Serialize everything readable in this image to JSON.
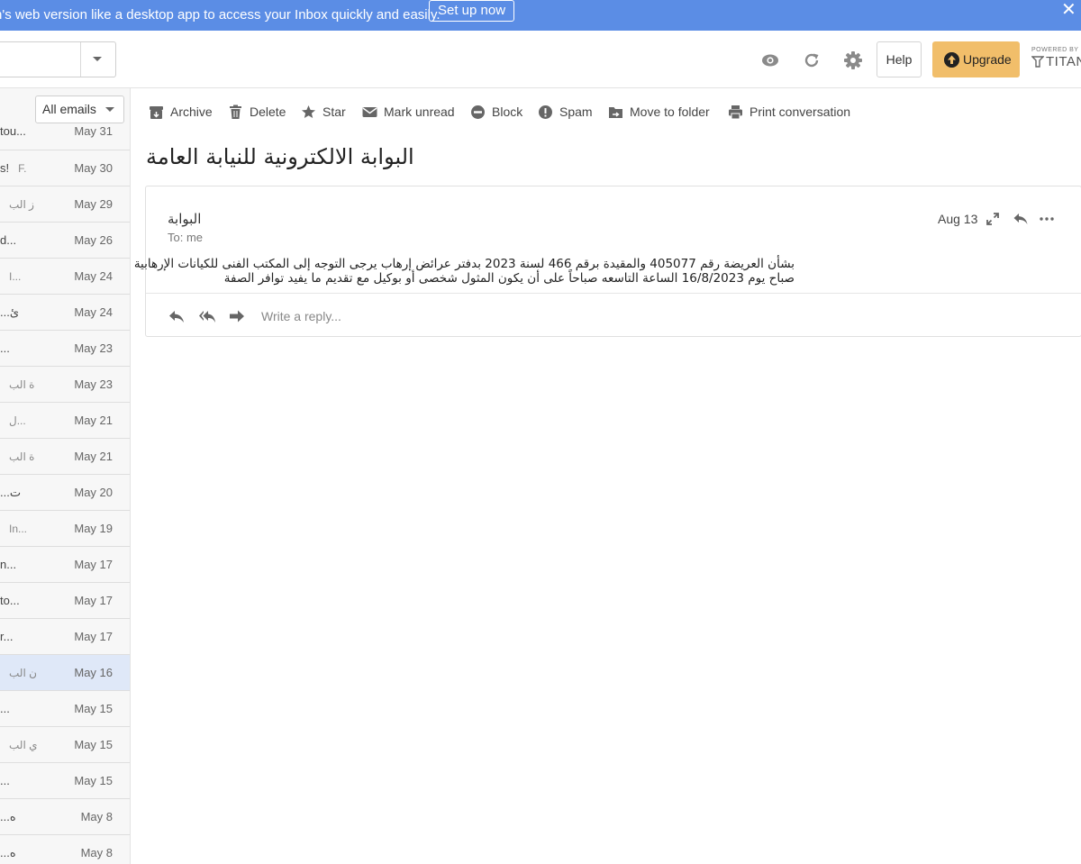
{
  "banner": {
    "text": "n's web version like a desktop app to access your Inbox quickly and easily.",
    "button_label": "Set up now",
    "close_glyph": "✕"
  },
  "header": {
    "help_label": "Help",
    "upgrade_label": "Upgrade",
    "powered_by": "POWERED BY",
    "brand": "TITAN",
    "icons": [
      "eye-icon",
      "refresh-icon",
      "settings-icon"
    ]
  },
  "sidebar": {
    "filter_value": "All emails",
    "rows": [
      {
        "snippet": "tou...",
        "date": "May 31"
      },
      {
        "snippet": "s!",
        "extra": "F.",
        "date": "May 30"
      },
      {
        "snippet": "",
        "extra": "ز  الب",
        "date": "May 29"
      },
      {
        "snippet": "d...",
        "date": "May 26"
      },
      {
        "snippet": "",
        "extra": "I...",
        "date": "May 24"
      },
      {
        "snippet": "...ئ",
        "date": "May 24"
      },
      {
        "snippet": "...",
        "date": "May 23"
      },
      {
        "snippet": "",
        "extra": "ة  الب",
        "date": "May 23"
      },
      {
        "snippet": "",
        "extra": "ل...",
        "date": "May 21"
      },
      {
        "snippet": "",
        "extra": "ة  الب",
        "date": "May 21"
      },
      {
        "snippet": "...ت",
        "date": "May 20"
      },
      {
        "snippet": "",
        "extra": "In...",
        "date": "May 19"
      },
      {
        "snippet": "n...",
        "date": "May 17"
      },
      {
        "snippet": "to...",
        "date": "May 17"
      },
      {
        "snippet": "r...",
        "date": "May 17"
      },
      {
        "snippet": "",
        "extra": "ن  الب",
        "date": "May 16",
        "selected": true
      },
      {
        "snippet": "...",
        "date": "May 15"
      },
      {
        "snippet": "",
        "extra": "ي  الب",
        "date": "May 15"
      },
      {
        "snippet": "...",
        "date": "May 15"
      },
      {
        "snippet": "...ه",
        "date": "May 8"
      },
      {
        "snippet": "...ه",
        "date": "May 8"
      }
    ]
  },
  "toolbar": {
    "items": [
      {
        "label": "Archive",
        "icon": "archive-icon"
      },
      {
        "label": "Delete",
        "icon": "trash-icon"
      },
      {
        "label": "Star",
        "icon": "star-icon"
      },
      {
        "label": "Mark unread",
        "icon": "envelope-icon"
      },
      {
        "label": "Block",
        "icon": "block-icon"
      },
      {
        "label": "Spam",
        "icon": "spam-icon"
      },
      {
        "label": "Move to folder",
        "icon": "folder-move-icon"
      },
      {
        "label": "Print conversation",
        "icon": "print-icon"
      }
    ]
  },
  "message": {
    "subject": "البوابة الالكترونية للنيابة العامة",
    "sender": "البوابة",
    "to": "To: me",
    "date": "Aug 13",
    "body_line1": "بشأن العريضة رقم 405077 والمقيدة برقم 466 لسنة 2023 بدفتر عرائض إرهاب يرجى التوجه إلى المكتب الفنى للكيانات الإرهابية",
    "body_line2": "صباح يوم 16/8/2023 الساعة التاسعه صباحاً على أن يكون المثول شخصى أو بوكيل مع تقديم ما يفيد توافر الصفة",
    "reply_placeholder": "Write a reply..."
  },
  "colors": {
    "banner": "#5b8de5",
    "upgrade": "#f1be6a",
    "selected_row": "#dfe8f8",
    "sidebar_bg": "#f7f7f7"
  }
}
